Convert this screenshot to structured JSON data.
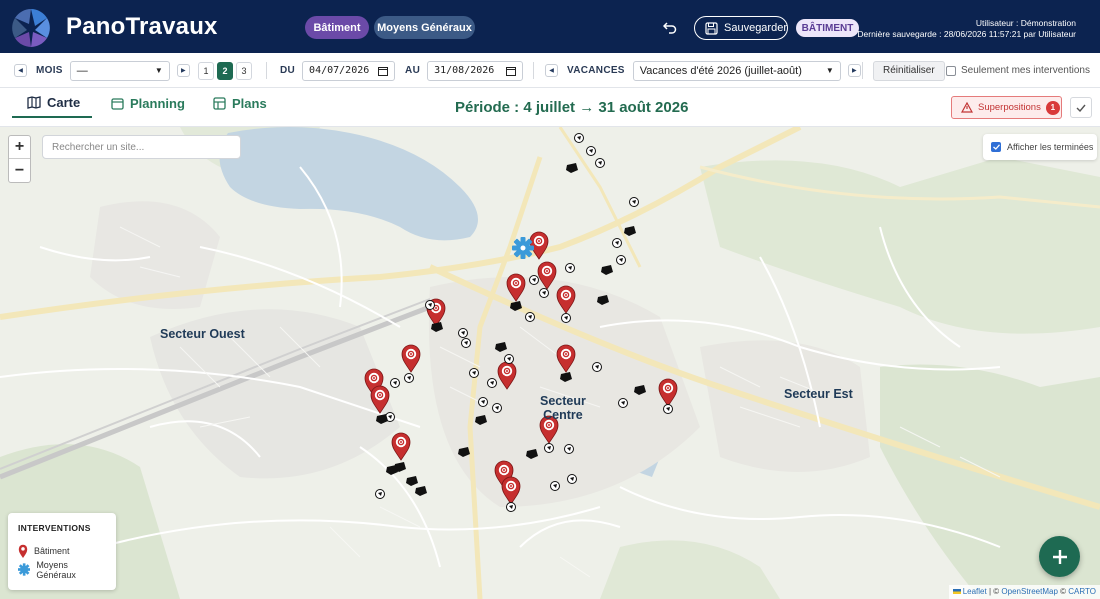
{
  "header": {
    "brand": "PanoTravaux",
    "pill_batiment": "Bâtiment",
    "pill_moyens": "Moyens Généraux",
    "save_label": "Sauvegarder",
    "badge": "BÂTIMENT",
    "user_line": "Utilisateur : Démonstration",
    "last_save_line": "Dernière sauvegarde : 28/06/2026 11:57:21 par Utilisateur",
    "colors": {
      "bg": "#0c2350",
      "pill_batiment": "#6b4aa8",
      "pill_moyens": "#3c5a86"
    }
  },
  "filters": {
    "mois_label": "MOIS",
    "mois_value": "—",
    "week_buttons": [
      "1",
      "2",
      "3"
    ],
    "week_active": "2",
    "du_label": "DU",
    "du_value": "04/07/2026",
    "au_label": "AU",
    "au_value": "31/08/2026",
    "vacances_label": "VACANCES",
    "vacances_value": "Vacances d'été 2026 (juillet-août)",
    "reset_label": "Réinitialiser",
    "only_mine_label": "Seulement mes interventions",
    "only_mine_checked": false
  },
  "tabs": [
    {
      "label": "Carte",
      "icon": "map-icon",
      "active": true
    },
    {
      "label": "Planning",
      "icon": "calendar-icon",
      "active": false
    },
    {
      "label": "Plans",
      "icon": "layout-icon",
      "active": false
    }
  ],
  "period": "Période : 4 juillet → 31 août 2026",
  "overlaps": {
    "label": "Superpositions",
    "count": "1"
  },
  "map": {
    "search_placeholder": "Rechercher un site...",
    "show_completed_label": "Afficher les terminées",
    "show_completed_checked": true,
    "sectors": {
      "ouest": "Secteur Ouest",
      "centre_line1": "Secteur",
      "centre_line2": "Centre",
      "est": "Secteur Est"
    },
    "legend": {
      "title": "INTERVENTIONS",
      "batiment": "Bâtiment",
      "moyens": "Moyens Généraux"
    },
    "attribution": {
      "leaflet": "Leaflet",
      "osm": "OpenStreetMap",
      "carto": "CARTO",
      "sep": "|",
      "copy": "©"
    },
    "colors": {
      "pin": "#c62f2f",
      "moyens": "#3b9ad9",
      "water": "#c3d5e2",
      "park": "#dbe5d1",
      "road_major": "#f3e7b9"
    }
  }
}
